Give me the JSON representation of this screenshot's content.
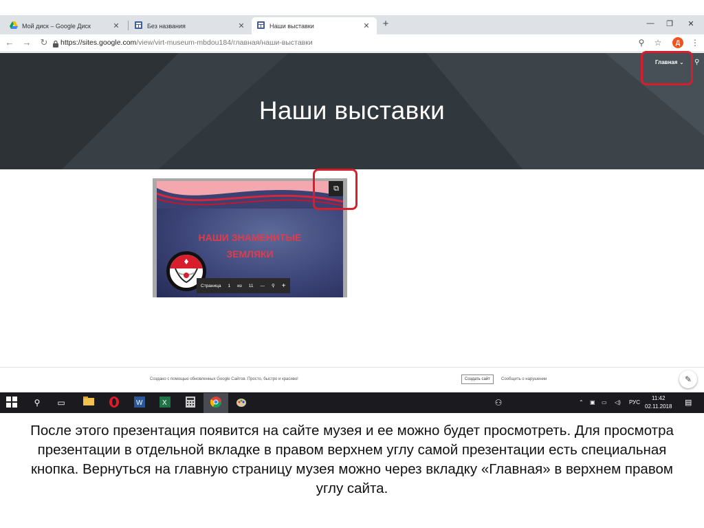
{
  "browser": {
    "tabs": [
      {
        "title": "Мой диск – Google Диск",
        "icon": "google-drive-icon",
        "active": false
      },
      {
        "title": "Без названия",
        "icon": "google-sites-icon",
        "active": false
      },
      {
        "title": "Наши выставки",
        "icon": "google-sites-icon",
        "active": true
      }
    ],
    "new_tab": "+",
    "url_main": "https://sites.google.com",
    "url_rest": "/view/virt-museum-mbdou184/главная/наши-выставки",
    "avatar_letter": "Д"
  },
  "site": {
    "nav_home": "Главная",
    "title": "Наши выставки",
    "slide": {
      "title_line1": "НАШИ ЗНАМЕНИТЫЕ",
      "title_line2": "ЗЕМЛЯКИ",
      "pager_label": "Страница",
      "pager_current": "1",
      "pager_of": "из",
      "pager_total": "11",
      "zoom_out": "—",
      "zoom_in": "+"
    },
    "footer": {
      "text": "Создано с помощью обновленных Google Сайтов. Просто, быстро и красиво!",
      "create_button": "Создать сайт",
      "report_link": "Сообщить о нарушении"
    }
  },
  "taskbar": {
    "lang": "РУС",
    "time": "11:42",
    "date": "02.11.2018"
  },
  "caption": "После этого презентация появится на сайте музея и ее можно будет просмотреть. Для просмотра презентации в отдельной вкладке в правом верхнем углу самой презентации есть специальная кнопка. Вернуться на главную страницу музея можно через вкладку «Главная» в верхнем правом углу сайта.",
  "colors": {
    "header_bg": "#343b40",
    "highlight": "#d81e2c",
    "slide_title": "#e23b4a"
  }
}
